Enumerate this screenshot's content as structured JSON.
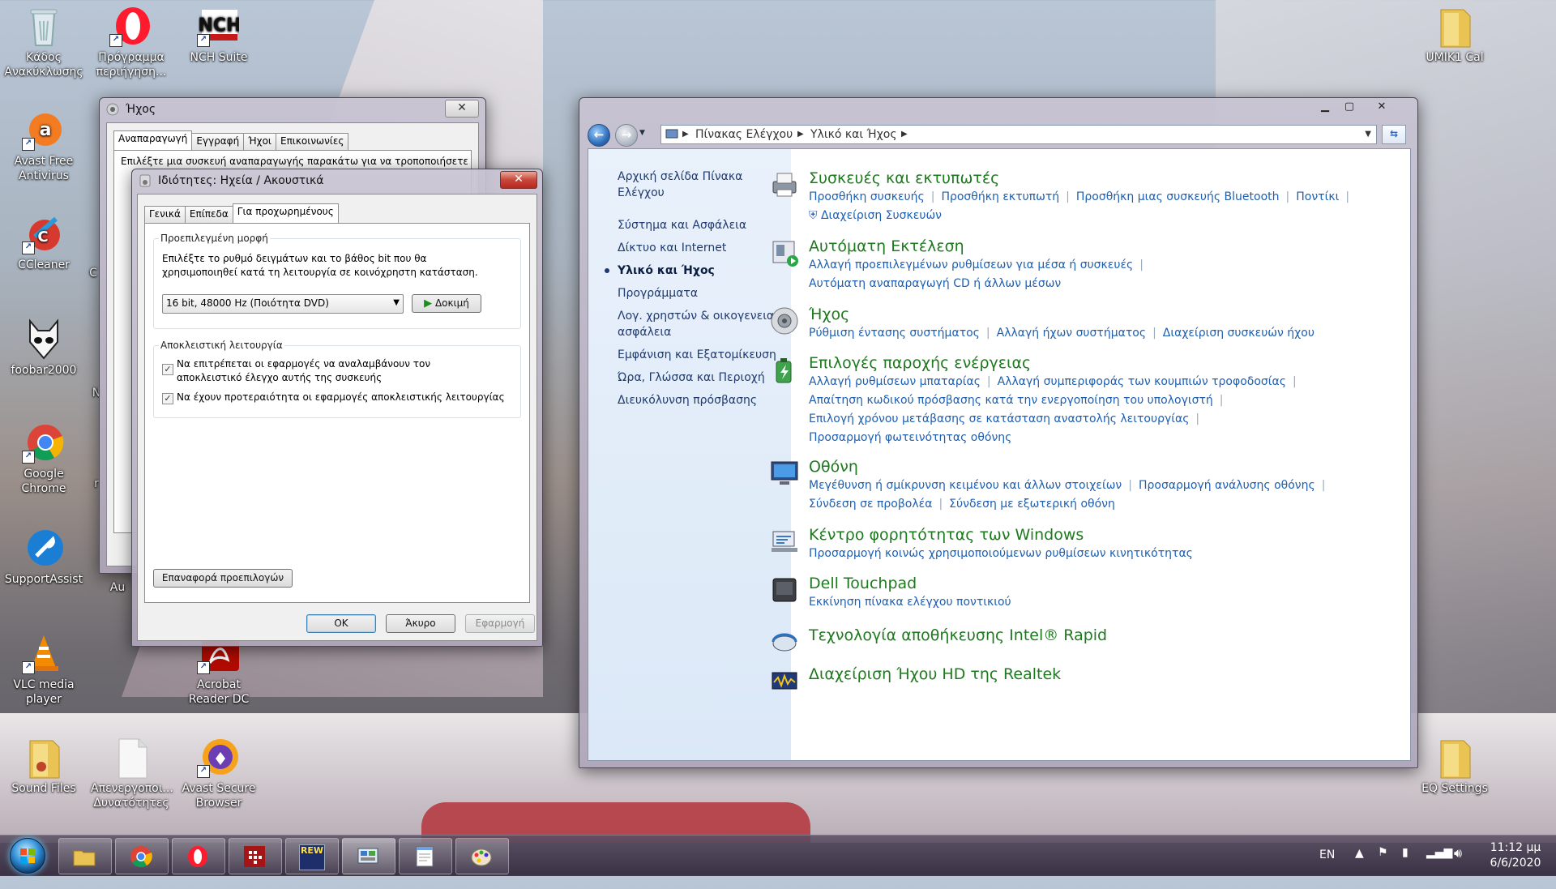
{
  "desktop": {
    "icons": [
      {
        "label": "Κάδος Ανακύκλωσης",
        "icon": "recycle-bin-icon"
      },
      {
        "label": "Πρόγραμμα περιήγηση...",
        "icon": "opera-icon"
      },
      {
        "label": "NCH Suite",
        "icon": "nch-icon"
      },
      {
        "label": "Avast Free Antivirus",
        "icon": "avast-icon"
      },
      {
        "label": "CCleaner",
        "icon": "ccleaner-icon"
      },
      {
        "label": "foobar2000",
        "icon": "foobar-icon"
      },
      {
        "label": "Google Chrome",
        "icon": "chrome-icon"
      },
      {
        "label": "SupportAssist",
        "icon": "supportassist-icon"
      },
      {
        "label": "VLC media player",
        "icon": "vlc-icon"
      },
      {
        "label": "Sound Files",
        "icon": "folder-icon"
      },
      {
        "label": "Απενεργοποι... Δυνατότητες",
        "icon": "file-icon"
      },
      {
        "label": "Avast Secure Browser",
        "icon": "avast-browser-icon"
      },
      {
        "label": "Acrobat Reader DC",
        "icon": "acrobat-icon"
      },
      {
        "label": "UMIK1 Cal",
        "icon": "folder-icon"
      },
      {
        "label": "EQ Settings",
        "icon": "folder-icon"
      }
    ],
    "partial_labels": [
      "C",
      "r",
      "N",
      "Au"
    ]
  },
  "sound_dialog": {
    "title": "Ήχος",
    "tabs": [
      "Αναπαραγωγή",
      "Εγγραφή",
      "Ήχοι",
      "Επικοινωνίες"
    ],
    "active_tab": 0,
    "hint": "Επιλέξτε μια συσκευή αναπαραγωγής παρακάτω για να τροποποιήσετε"
  },
  "props_dialog": {
    "title": "Ιδιότητες: Ηχεία / Ακουστικά",
    "tabs": [
      "Γενικά",
      "Επίπεδα",
      "Για προχωρημένους"
    ],
    "active_tab": 2,
    "default_format": {
      "group_label": "Προεπιλεγμένη μορφή",
      "description": "Επιλέξτε το ρυθμό δειγμάτων και το βάθος bit που θα χρησιμοποιηθεί κατά τη λειτουργία σε κοινόχρηστη κατάσταση.",
      "selected": "16 bit, 48000 Hz (Ποιότητα DVD)",
      "test_label": "Δοκιμή"
    },
    "exclusive": {
      "group_label": "Αποκλειστική λειτουργία",
      "options": [
        {
          "label": "Να επιτρέπεται οι εφαρμογές να αναλαμβάνουν τον αποκλειστικό έλεγχο αυτής της συσκευής",
          "checked": true
        },
        {
          "label": "Να έχουν προτεραιότητα οι εφαρμογές αποκλειστικής λειτουργίας",
          "checked": true
        }
      ]
    },
    "restore_label": "Επαναφορά προεπιλογών",
    "ok_label": "ΟΚ",
    "cancel_label": "Άκυρο",
    "apply_label": "Εφαρμογή"
  },
  "control_panel": {
    "breadcrumb": [
      "Πίνακας Ελέγχου",
      "Υλικό και Ήχος"
    ],
    "sidebar": [
      {
        "label": "Αρχική σελίδα Πίνακα Ελέγχου",
        "current": false
      },
      {
        "label": "Σύστημα και Ασφάλεια",
        "current": false
      },
      {
        "label": "Δίκτυο και Internet",
        "current": false
      },
      {
        "label": "Υλικό και Ήχος",
        "current": true
      },
      {
        "label": "Προγράμματα",
        "current": false
      },
      {
        "label": "Λογ. χρηστών & οικογενειακή ασφάλεια",
        "current": false
      },
      {
        "label": "Εμφάνιση και Εξατομίκευση",
        "current": false
      },
      {
        "label": "Ώρα, Γλώσσα και Περιοχή",
        "current": false
      },
      {
        "label": "Διευκόλυνση πρόσβασης",
        "current": false
      }
    ],
    "categories": [
      {
        "title": "Συσκευές και εκτυπωτές",
        "icon": "printer-icon",
        "rows": [
          [
            "Προσθήκη συσκευής",
            "Προσθήκη εκτυπωτή",
            "Προσθήκη μιας συσκευής Bluetooth",
            "Ποντίκι"
          ],
          [
            "Διαχείριση Συσκευών"
          ]
        ]
      },
      {
        "title": "Αυτόματη Εκτέλεση",
        "icon": "autoplay-icon",
        "rows": [
          [
            "Αλλαγή προεπιλεγμένων ρυθμίσεων για μέσα ή συσκευές"
          ],
          [
            "Αυτόματη αναπαραγωγή CD ή άλλων μέσων"
          ]
        ]
      },
      {
        "title": "Ήχος",
        "icon": "speaker-icon",
        "rows": [
          [
            "Ρύθμιση έντασης συστήματος",
            "Αλλαγή ήχων συστήματος",
            "Διαχείριση συσκευών ήχου"
          ]
        ]
      },
      {
        "title": "Επιλογές παροχής ενέργειας",
        "icon": "power-options-icon",
        "rows": [
          [
            "Αλλαγή ρυθμίσεων μπαταρίας",
            "Αλλαγή συμπεριφοράς των κουμπιών τροφοδοσίας"
          ],
          [
            "Απαίτηση κωδικού πρόσβασης κατά την ενεργοποίηση του υπολογιστή"
          ],
          [
            "Επιλογή χρόνου μετάβασης σε κατάσταση αναστολής λειτουργίας"
          ],
          [
            "Προσαρμογή φωτεινότητας οθόνης"
          ]
        ]
      },
      {
        "title": "Οθόνη",
        "icon": "display-icon",
        "rows": [
          [
            "Μεγέθυνση ή σμίκρυνση κειμένου και άλλων στοιχείων",
            "Προσαρμογή ανάλυσης οθόνης"
          ],
          [
            "Σύνδεση σε προβολέα",
            "Σύνδεση με εξωτερική οθόνη"
          ]
        ]
      },
      {
        "title": "Κέντρο φορητότητας των Windows",
        "icon": "mobility-center-icon",
        "rows": [
          [
            "Προσαρμογή κοινώς χρησιμοποιούμενων ρυθμίσεων κινητικότητας"
          ]
        ]
      },
      {
        "title": "Dell Touchpad",
        "icon": "touchpad-icon",
        "rows": [
          [
            "Εκκίνηση πίνακα ελέγχου ποντικιού"
          ]
        ]
      },
      {
        "title": "Τεχνολογία αποθήκευσης Intel® Rapid",
        "icon": "intel-rapid-icon",
        "rows": []
      },
      {
        "title": "Διαχείριση Ήχου HD της Realtek",
        "icon": "realtek-icon",
        "rows": []
      }
    ]
  },
  "taskbar": {
    "apps": [
      "explorer-icon",
      "chrome-icon",
      "opera-icon",
      "nch-icon",
      "rew-icon",
      "control-panel-icon",
      "notepad-icon",
      "paint-icon"
    ],
    "rew_label": "REW",
    "language": "EN",
    "time": "11:12 μμ",
    "date": "6/6/2020"
  }
}
